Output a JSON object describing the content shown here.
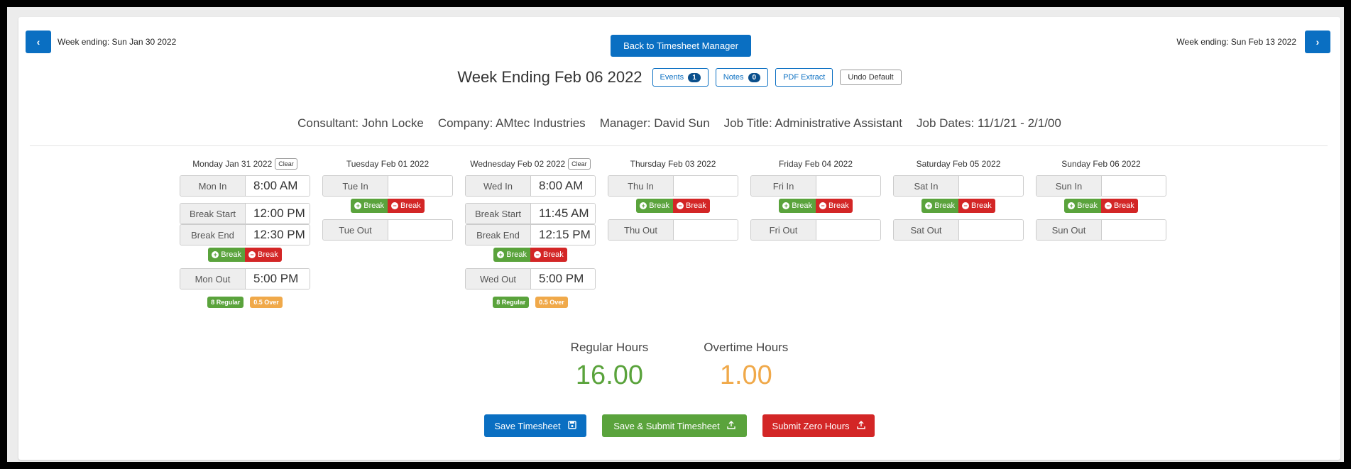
{
  "nav": {
    "prev_label": "Week ending: Sun Jan 30 2022",
    "next_label": "Week ending: Sun Feb 13 2022",
    "prev_glyph": "‹",
    "next_glyph": "›",
    "back_button": "Back to Timesheet Manager"
  },
  "header": {
    "title": "Week Ending Feb 06 2022",
    "events_label": "Events",
    "events_count": "1",
    "notes_label": "Notes",
    "notes_count": "0",
    "pdf_label": "PDF Extract",
    "undo_label": "Undo Default"
  },
  "info": {
    "consultant": "Consultant: John Locke",
    "company": "Company: AMtec Industries",
    "manager": "Manager: David Sun",
    "job_title": "Job Title: Administrative Assistant",
    "job_dates": "Job Dates: 11/1/21 - 2/1/00"
  },
  "common": {
    "clear": "Clear",
    "add_break": "Break",
    "remove_break": "Break",
    "plus": "+",
    "minus": "−"
  },
  "days": [
    {
      "title": "Monday Jan 31 2022",
      "in_label": "Mon In",
      "in_value": "8:00 AM",
      "break_start_label": "Break Start",
      "break_start_value": "12:00 PM",
      "break_end_label": "Break End",
      "break_end_value": "12:30 PM",
      "out_label": "Mon Out",
      "out_value": "5:00 PM",
      "regular": "8 Regular",
      "over": "0.5 Over"
    },
    {
      "title": "Tuesday Feb 01 2022",
      "in_label": "Tue In",
      "in_value": "",
      "out_label": "Tue Out",
      "out_value": ""
    },
    {
      "title": "Wednesday Feb 02 2022",
      "in_label": "Wed In",
      "in_value": "8:00 AM",
      "break_start_label": "Break Start",
      "break_start_value": "11:45 AM",
      "break_end_label": "Break End",
      "break_end_value": "12:15 PM",
      "out_label": "Wed Out",
      "out_value": "5:00 PM",
      "regular": "8 Regular",
      "over": "0.5 Over"
    },
    {
      "title": "Thursday Feb 03 2022",
      "in_label": "Thu In",
      "in_value": "",
      "out_label": "Thu Out",
      "out_value": ""
    },
    {
      "title": "Friday Feb 04 2022",
      "in_label": "Fri In",
      "in_value": "",
      "out_label": "Fri Out",
      "out_value": ""
    },
    {
      "title": "Saturday Feb 05 2022",
      "in_label": "Sat In",
      "in_value": "",
      "out_label": "Sat Out",
      "out_value": ""
    },
    {
      "title": "Sunday Feb 06 2022",
      "in_label": "Sun In",
      "in_value": "",
      "out_label": "Sun Out",
      "out_value": ""
    }
  ],
  "totals": {
    "regular_label": "Regular Hours",
    "regular_value": "16.00",
    "overtime_label": "Overtime Hours",
    "overtime_value": "1.00"
  },
  "actions": {
    "save": "Save Timesheet",
    "save_submit": "Save & Submit Timesheet",
    "submit_zero": "Submit Zero Hours"
  },
  "icons": {
    "save": "floppy-disk-icon",
    "upload": "upload-icon"
  },
  "colors": {
    "primary": "#0a6fc2",
    "success": "#5aa33c",
    "danger": "#d32626",
    "warning": "#f0a94a"
  }
}
